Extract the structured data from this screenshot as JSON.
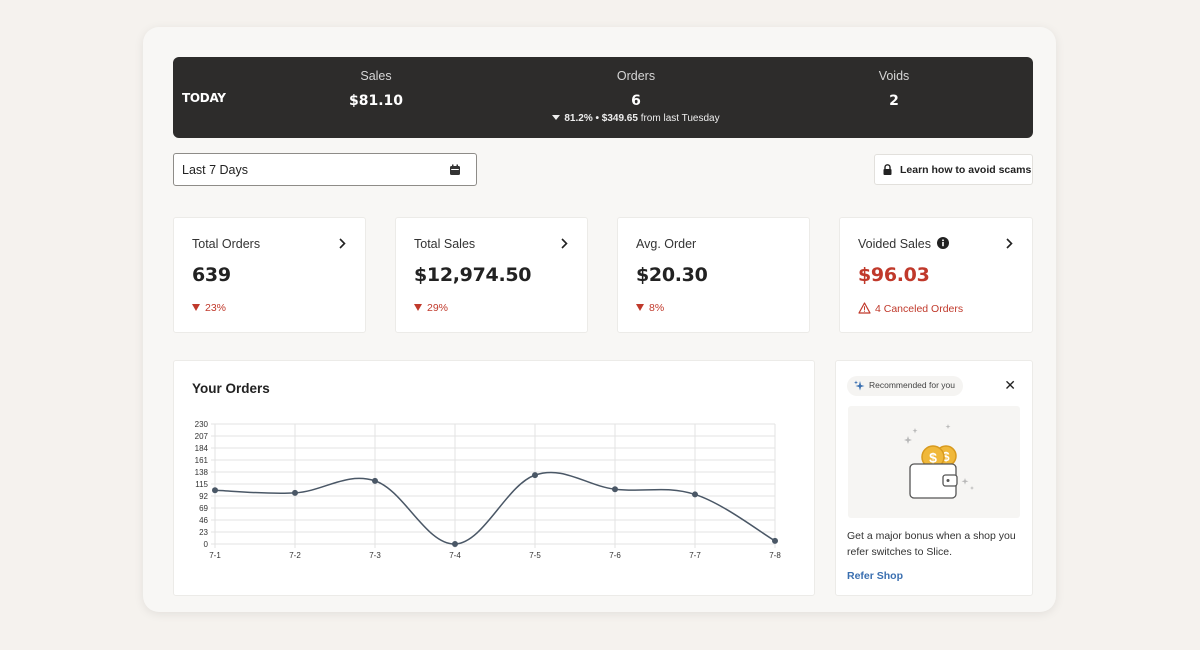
{
  "today_bar": {
    "label": "TODAY",
    "sales_label": "Sales",
    "sales_value": "$81.10",
    "orders_label": "Orders",
    "orders_value": "6",
    "voids_label": "Voids",
    "voids_value": "2",
    "delta_bold": "81.2% • $349.65",
    "delta_suffix": " from last Tuesday"
  },
  "filters": {
    "date_range": "Last 7 Days",
    "scam_button": "Learn how to avoid scams"
  },
  "cards": [
    {
      "label": "Total Orders",
      "value": "639",
      "delta": "23%"
    },
    {
      "label": "Total Sales",
      "value": "$12,974.50",
      "delta": "29%"
    },
    {
      "label": "Avg. Order",
      "value": "$20.30",
      "delta": "8%"
    },
    {
      "label": "Voided Sales",
      "value": "$96.03",
      "delta": "4 Canceled Orders"
    }
  ],
  "orders_panel": {
    "title": "Your Orders"
  },
  "chart_data": {
    "type": "line",
    "title": "Your Orders",
    "categories": [
      "7-1",
      "7-2",
      "7-3",
      "7-4",
      "7-5",
      "7-6",
      "7-7",
      "7-8"
    ],
    "values": [
      103,
      98,
      121,
      0,
      132,
      105,
      95,
      6
    ],
    "y_ticks": [
      0,
      23,
      46,
      69,
      92,
      115,
      138,
      161,
      184,
      207,
      230
    ],
    "ylim": [
      0,
      230
    ],
    "grid": true,
    "line_color": "#4a5766"
  },
  "recommendation": {
    "badge": "Recommended for you",
    "close": "✕",
    "body": "Get a major bonus when a shop you refer switches to Slice.",
    "link": "Refer Shop"
  },
  "colors": {
    "dark_bar": "#2d2c2b",
    "negative": "#c0392b",
    "link": "#3a6fb0",
    "coin": "#f0b83a"
  }
}
